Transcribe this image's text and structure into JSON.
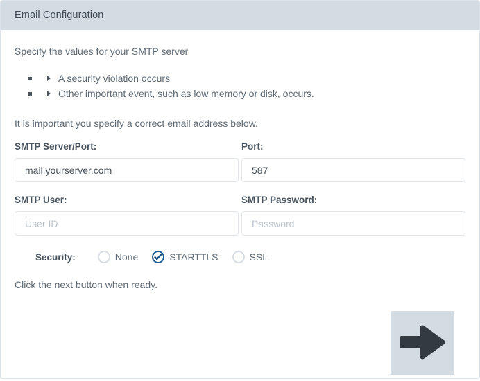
{
  "window": {
    "header_title": "Email Configuration",
    "header_bg": "#d4dce3",
    "panel_border": "#dde3ea"
  },
  "body": {
    "intro_text": "Specify the values for your SMTP server",
    "event_list": [
      {
        "bullet_icon": "square-bullet-icon",
        "arrow_icon": "triangle-right-icon",
        "label": "A security violation occurs"
      },
      {
        "bullet_icon": "square-bullet-icon",
        "arrow_icon": "triangle-right-icon",
        "label": "Other important event, such as low memory or disk, occurs."
      }
    ],
    "note_text": "It is important you specify a correct email address below.",
    "ready_text": "Click the next button when ready."
  },
  "form": {
    "fields": [
      {
        "label": "SMTP Server/Port:",
        "value": "mail.yourserver.com",
        "placeholder": ""
      },
      {
        "label": "Port:",
        "value": "587",
        "placeholder": ""
      },
      {
        "label": "SMTP User:",
        "value": "",
        "placeholder": "User ID"
      },
      {
        "label": "SMTP Password:",
        "value": "",
        "placeholder": "Password"
      }
    ],
    "security": {
      "label": "Security:",
      "selected": "STARTTLS",
      "accent_color": "#1c5e97",
      "options": [
        {
          "label": "None",
          "checked": false
        },
        {
          "label": "STARTTLS",
          "checked": true
        },
        {
          "label": "SSL",
          "checked": false
        }
      ]
    }
  },
  "next_button": {
    "icon": "arrow-right-icon",
    "label": "",
    "bg": "#d4dce3",
    "arrow_color": "#333a40"
  }
}
